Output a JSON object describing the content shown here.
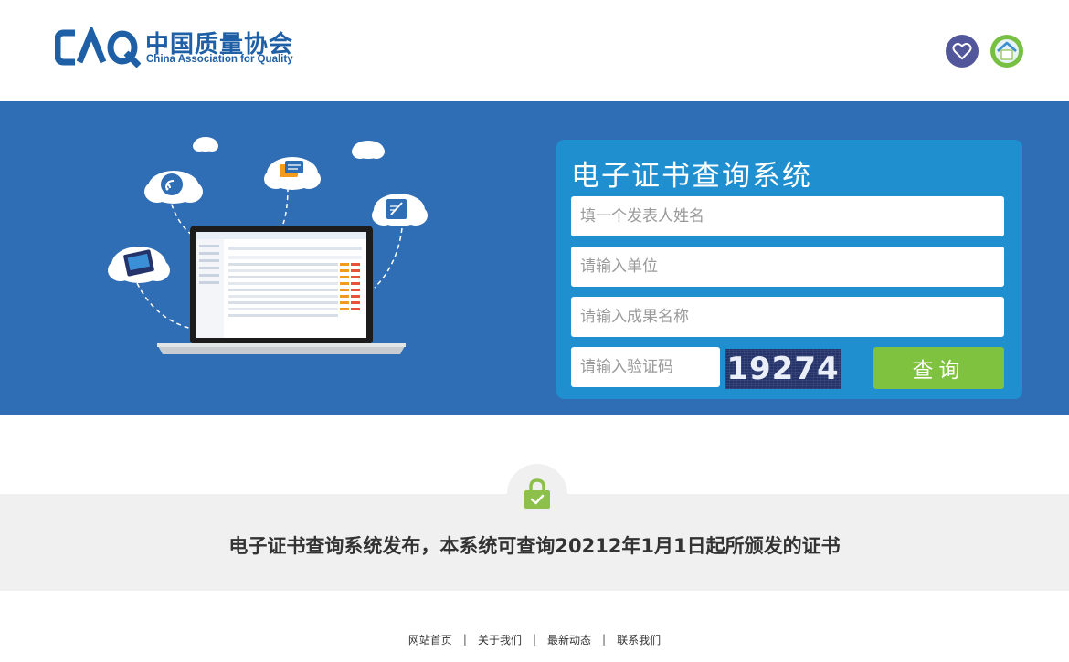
{
  "header": {
    "logo": {
      "mark": "CAQ",
      "name_cn": "中国质量协会",
      "name_en": "China Association for Quality"
    },
    "icons": [
      "heart-icon",
      "home-icon"
    ]
  },
  "query_panel": {
    "title": "电子证书查询系统",
    "author_placeholder": "填一个发表人姓名",
    "unit_placeholder": "请输入单位",
    "result_placeholder": "请输入成果名称",
    "captcha_placeholder": "请输入验证码",
    "captcha_value": "19274",
    "submit_label": "查询"
  },
  "notice": {
    "text": "电子证书查询系统发布，本系统可查询20212年1月1日起所颁发的证书"
  },
  "footer": {
    "links": [
      "网站首页",
      "关于我们",
      "最新动态",
      "联系我们"
    ],
    "separator": "|"
  },
  "colors": {
    "brand_blue": "#1f5fa6",
    "banner": "#2f6db4",
    "panel": "#1f8fcf",
    "button_green": "#7ec23f"
  }
}
